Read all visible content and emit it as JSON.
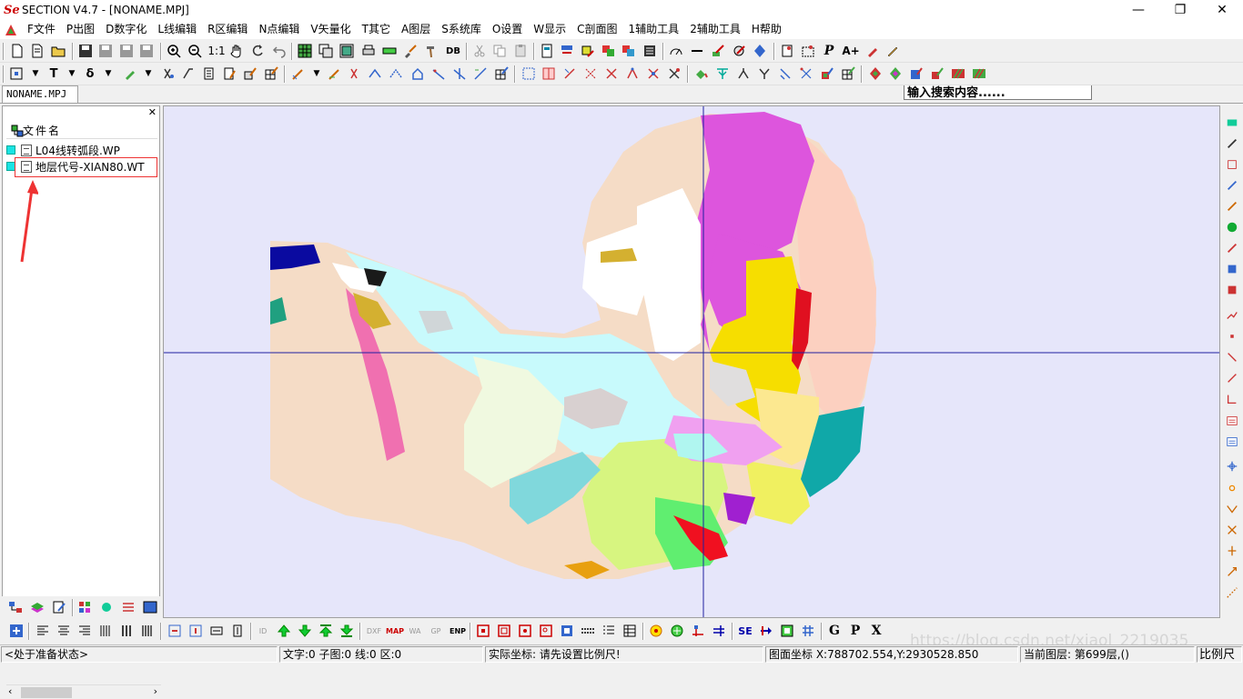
{
  "window": {
    "logo": "Se",
    "title": "SECTION V4.7 - [NONAME.MPJ]",
    "minimize_icon": "minimize-icon",
    "restore_icon": "restore-icon",
    "close_icon": "close-icon"
  },
  "menu": {
    "items": [
      "F文件",
      "P出图",
      "D数字化",
      "L线编辑",
      "R区编辑",
      "N点编辑",
      "V矢量化",
      "T其它",
      "A图层",
      "S系统库",
      "O设置",
      "W显示",
      "C剖面图",
      "1辅助工具",
      "2辅助工具",
      "H帮助"
    ]
  },
  "toolbar1": {
    "zoom_ratio": "1:1",
    "db_label": "DB",
    "p_label": "P",
    "a_plus_label": "A+",
    "search_value": "输入搜索内容......"
  },
  "toolbar2": {
    "t_label": "T",
    "delta_label": "δ"
  },
  "doc_tab": "NONAME.MPJ",
  "sidebar": {
    "header": "文件名",
    "files": [
      "L04线转弧段.WP",
      "地层代号-XIAN80.WT"
    ],
    "vis_color": "#19e3e3",
    "highlight_color": "#e33333"
  },
  "bottom_toolbar": {
    "id_label": "ID",
    "dxf_label": "DXF",
    "map_label": "MAP",
    "wa_label": "WA",
    "gp_label": "GP",
    "enp_label": "ENP",
    "se_label": "SE",
    "g_label": "G",
    "p_label": "P",
    "x_label": "X"
  },
  "status": {
    "state": "<处于准备状态>",
    "counts": "文字:0 子图:0 线:0 区:0",
    "actual_coords": "实际坐标: 请先设置比例尺!",
    "map_coords": "图面坐标 X:788702.554,Y:2930528.850",
    "current_layer": "当前图层: 第699层,()",
    "scale_button": "比例尺"
  },
  "watermark": "https://blog.csdn.net/xiaol_2219035"
}
